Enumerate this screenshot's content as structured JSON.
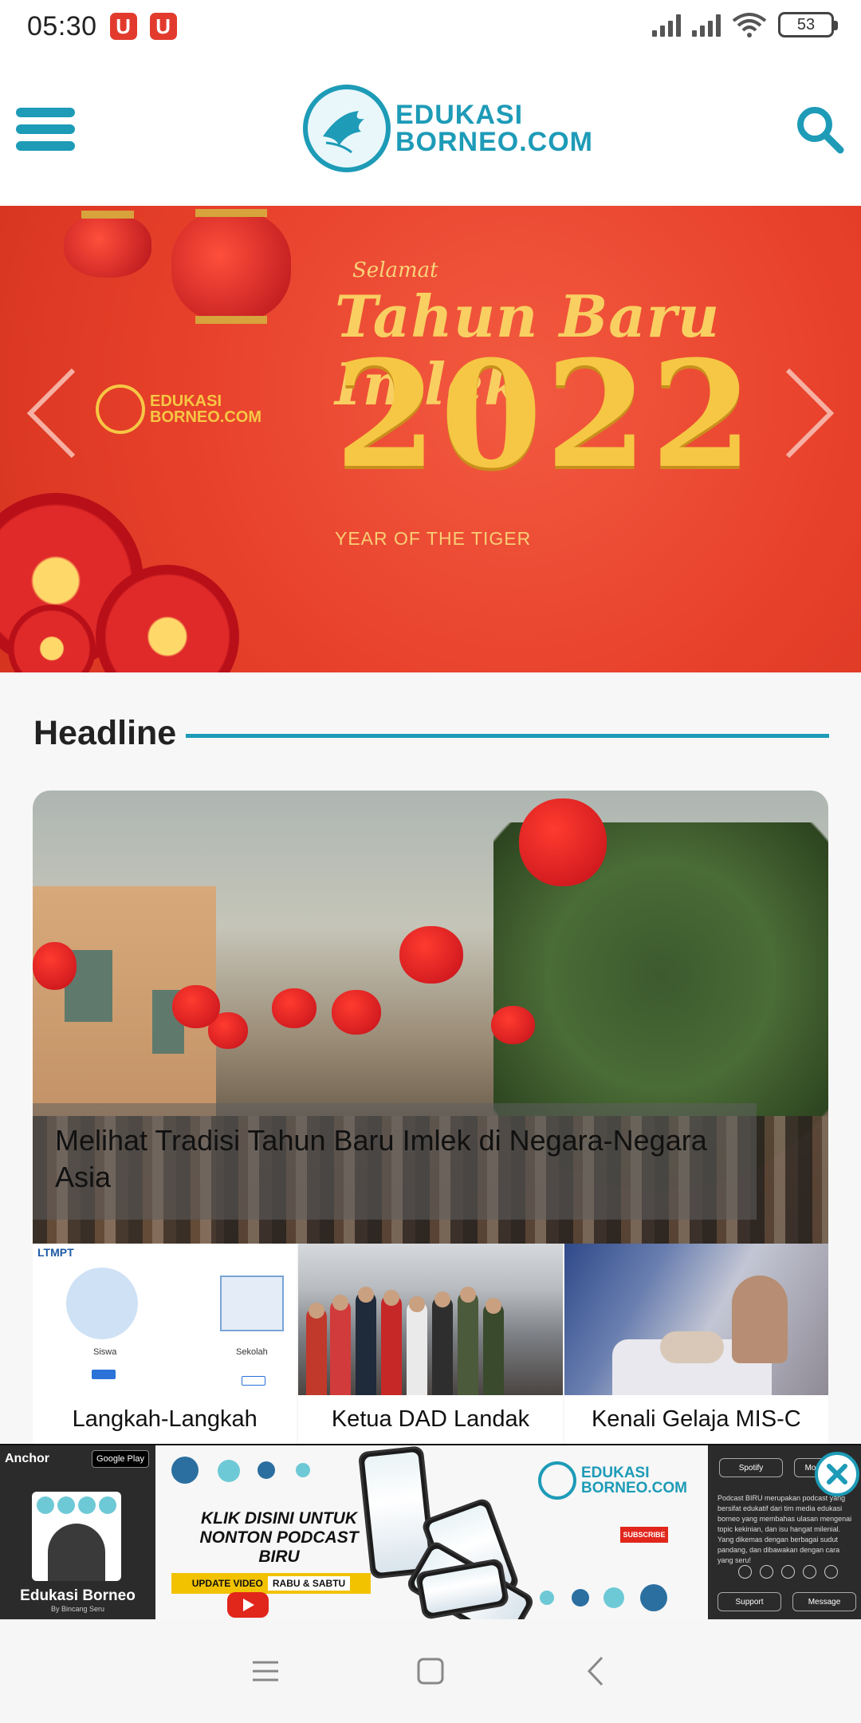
{
  "status_bar": {
    "time": "05:30",
    "battery": "53",
    "notification_icons": [
      "U",
      "U"
    ]
  },
  "header": {
    "logo_line1": "EDUKASI",
    "logo_line2": "BORNEO.COM",
    "menu_icon": "hamburger-menu-icon",
    "search_icon": "search-icon"
  },
  "banner": {
    "greeting": "Selamat",
    "title": "Tahun Baru Imlek",
    "year": "2022",
    "subtitle": "YEAR OF THE TIGER",
    "logo_line1": "EDUKASI",
    "logo_line2": "BORNEO.COM"
  },
  "headline": {
    "section_title": "Headline",
    "main_article_title": "Melihat Tradisi Tahun Baru Imlek di Negara-Negara Asia",
    "thumbnails": [
      {
        "title": "Langkah-Langkah"
      },
      {
        "title": "Ketua DAD Landak"
      },
      {
        "title": "Kenali Gelaja MIS-C"
      }
    ],
    "thumb1_image": {
      "brand": "LTMPT",
      "left_label": "Siswa",
      "right_label": "Sekolah"
    }
  },
  "ad": {
    "anchor_label": "Anchor",
    "gplay_label": "Google Play",
    "show_name": "Edukasi Borneo",
    "show_by": "By Bincang Seru",
    "cta": "KLIK DISINI UNTUK NONTON PODCAST BIRU",
    "update_label": "UPDATE VIDEO",
    "update_days": "RABU & SABTU",
    "brand_line1": "EDUKASI",
    "brand_line2": "BORNEO.COM",
    "subscribe_label": "SUBSCRIBE",
    "spotify_label": "Spotify",
    "more_label": "More",
    "description": "Podcast BIRU merupakan podcast yang bersifat edukatif dari tim media edukasi borneo yang membahas ulasan mengenai topic kekinian, dan isu hangat milenial. Yang dikemas dengan berbagai sudut pandang, dan dibawakan dengan cara yang seru!",
    "support_label": "Support",
    "message_label": "Message"
  },
  "colors": {
    "brand": "#1d9bb7",
    "banner_red": "#e8412b",
    "gold": "#f6c744"
  }
}
